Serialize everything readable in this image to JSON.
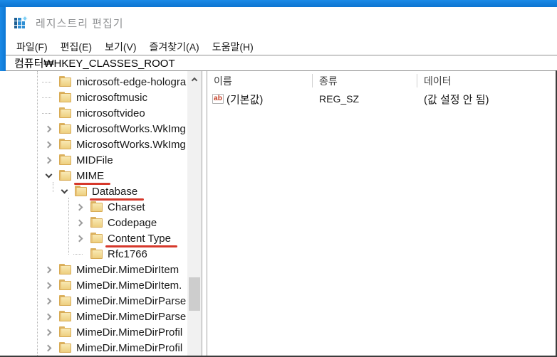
{
  "window": {
    "title": "레지스트리 편집기"
  },
  "menu": {
    "items": [
      {
        "label": "파일(F)"
      },
      {
        "label": "편집(E)"
      },
      {
        "label": "보기(V)"
      },
      {
        "label": "즐겨찾기(A)"
      },
      {
        "label": "도움말(H)"
      }
    ]
  },
  "address": {
    "value": "컴퓨터₩HKEY_CLASSES_ROOT"
  },
  "tree": {
    "items": [
      {
        "label": "microsoft-edge-hologra",
        "level": 0,
        "expander": "none",
        "underline": false
      },
      {
        "label": "microsoftmusic",
        "level": 0,
        "expander": "none",
        "underline": false
      },
      {
        "label": "microsoftvideo",
        "level": 0,
        "expander": "none",
        "underline": false
      },
      {
        "label": "MicrosoftWorks.WkImg",
        "level": 0,
        "expander": "collapsed",
        "underline": false
      },
      {
        "label": "MicrosoftWorks.WkImg",
        "level": 0,
        "expander": "collapsed",
        "underline": false
      },
      {
        "label": "MIDFile",
        "level": 0,
        "expander": "collapsed",
        "underline": false
      },
      {
        "label": "MIME",
        "level": 0,
        "expander": "expanded",
        "underline": true
      },
      {
        "label": "Database",
        "level": 1,
        "expander": "expanded",
        "underline": true
      },
      {
        "label": "Charset",
        "level": 2,
        "expander": "collapsed",
        "underline": false
      },
      {
        "label": "Codepage",
        "level": 2,
        "expander": "collapsed",
        "underline": false
      },
      {
        "label": "Content Type",
        "level": 2,
        "expander": "collapsed",
        "underline": true
      },
      {
        "label": "Rfc1766",
        "level": 2,
        "expander": "none",
        "underline": false
      },
      {
        "label": "MimeDir.MimeDirItem",
        "level": 0,
        "expander": "collapsed",
        "underline": false
      },
      {
        "label": "MimeDir.MimeDirItem.",
        "level": 0,
        "expander": "collapsed",
        "underline": false
      },
      {
        "label": "MimeDir.MimeDirParse",
        "level": 0,
        "expander": "collapsed",
        "underline": false
      },
      {
        "label": "MimeDir.MimeDirParse",
        "level": 0,
        "expander": "collapsed",
        "underline": false
      },
      {
        "label": "MimeDir.MimeDirProfil",
        "level": 0,
        "expander": "collapsed",
        "underline": false
      },
      {
        "label": "MimeDir.MimeDirProfil",
        "level": 0,
        "expander": "collapsed",
        "underline": false
      }
    ]
  },
  "list": {
    "columns": [
      {
        "label": "이름"
      },
      {
        "label": "종류"
      },
      {
        "label": "데이터"
      }
    ],
    "rows": [
      {
        "icon": "string-value-icon",
        "icon_text": "ab",
        "name": "(기본값)",
        "type": "REG_SZ",
        "data": "(값 설정 안 됨)"
      }
    ]
  },
  "colors": {
    "accent_blue": "#1181dd",
    "annotation_red": "#d6382b",
    "folder_yellow": "#eecf7f",
    "scrollbar_thumb": "#cdcdcd"
  }
}
